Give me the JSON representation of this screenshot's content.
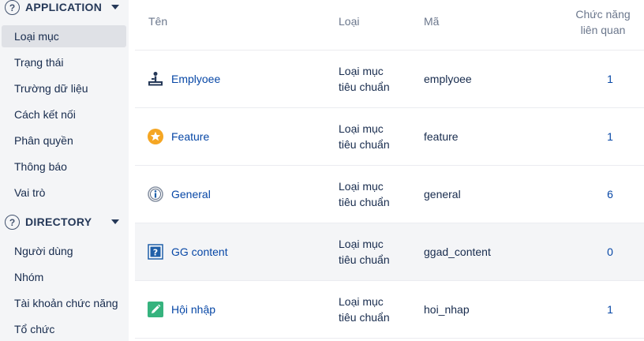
{
  "sidebar": {
    "sections": [
      {
        "title": "APPLICATION",
        "items": [
          "Loại mục",
          "Trạng thái",
          "Trường dữ liệu",
          "Cách kết nối",
          "Phân quyền",
          "Thông báo",
          "Vai trò"
        ]
      },
      {
        "title": "DIRECTORY",
        "items": [
          "Người dùng",
          "Nhóm",
          "Tài khoản chức năng",
          "Tổ chức"
        ]
      }
    ],
    "help_glyph": "?",
    "active_item": "Loại mục"
  },
  "table": {
    "headers": {
      "name": "Tên",
      "type": "Loại",
      "key": "Mã",
      "count_line1": "Chức năng",
      "count_line2": "liên quan"
    },
    "rows": [
      {
        "name": "Emplyoee",
        "type_line1": "Loại mục",
        "type_line2": "tiêu chuẩn",
        "key": "emplyoee",
        "count": "1",
        "icon": "employee-icon"
      },
      {
        "name": "Feature",
        "type_line1": "Loại mục",
        "type_line2": "tiêu chuẩn",
        "key": "feature",
        "count": "1",
        "icon": "star-icon"
      },
      {
        "name": "General",
        "type_line1": "Loại mục",
        "type_line2": "tiêu chuẩn",
        "key": "general",
        "count": "6",
        "icon": "info-icon"
      },
      {
        "name": "GG content",
        "type_line1": "Loại mục",
        "type_line2": "tiêu chuẩn",
        "key": "ggad_content",
        "count": "0",
        "icon": "question-square-icon"
      },
      {
        "name": "Hội nhập",
        "type_line1": "Loại mục",
        "type_line2": "tiêu chuẩn",
        "key": "hoi_nhap",
        "count": "1",
        "icon": "edit-icon"
      }
    ]
  },
  "colors": {
    "link": "#0747a6",
    "sidebar_bg": "#f4f5f7",
    "active_bg": "#dfe1e6",
    "star": "#f5a623",
    "edit": "#36b37e",
    "question_square": "#1f5fa8"
  }
}
